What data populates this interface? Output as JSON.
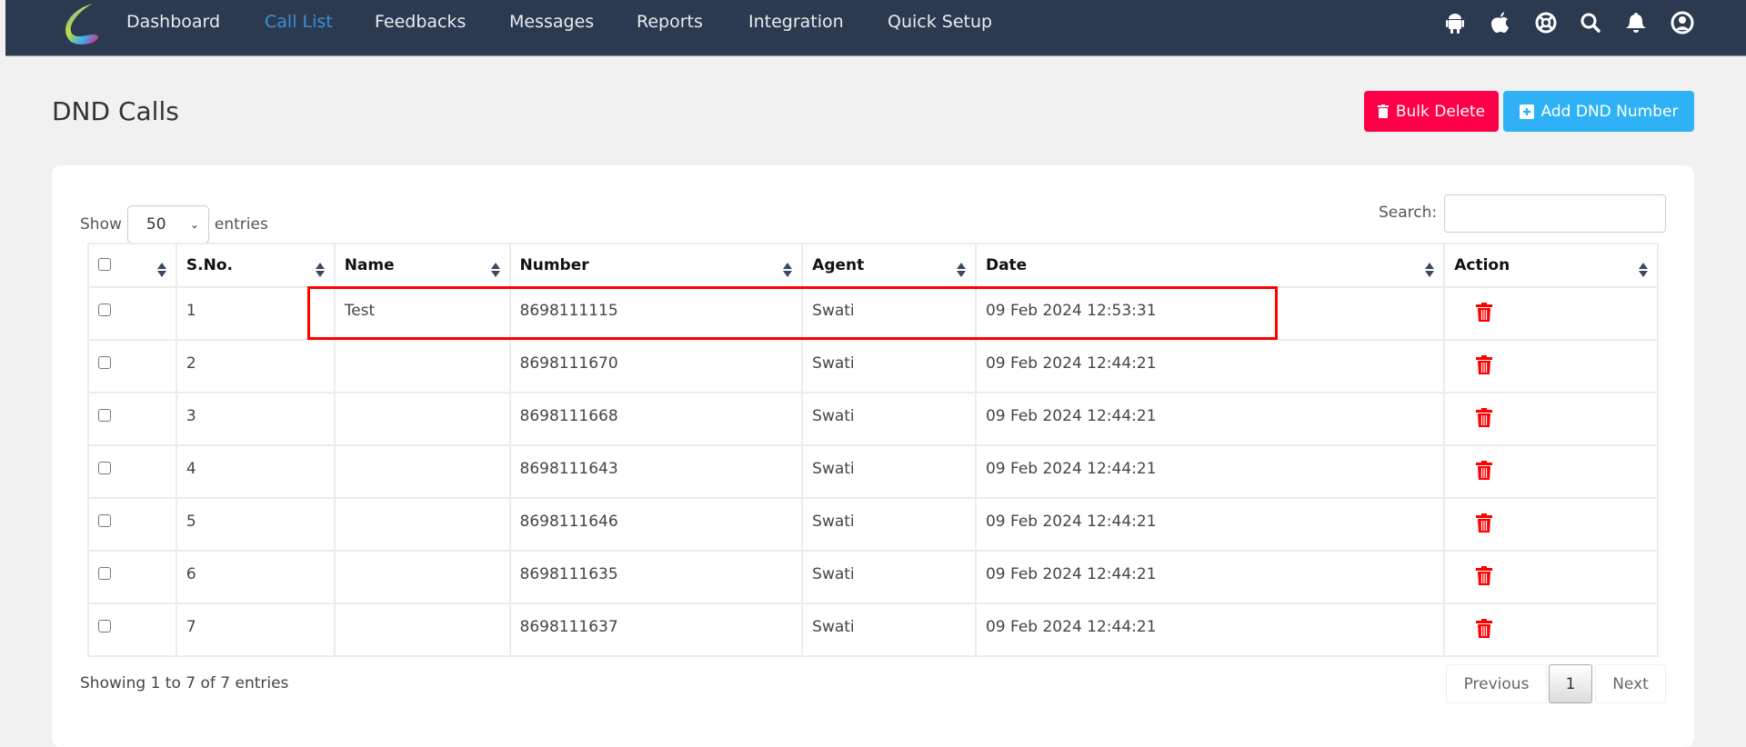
{
  "nav": {
    "items": [
      {
        "label": "Dashboard",
        "active": false
      },
      {
        "label": "Call List",
        "active": true
      },
      {
        "label": "Feedbacks",
        "active": false
      },
      {
        "label": "Messages",
        "active": false
      },
      {
        "label": "Reports",
        "active": false
      },
      {
        "label": "Integration",
        "active": false
      },
      {
        "label": "Quick Setup",
        "active": false
      }
    ],
    "icons": [
      "android-icon",
      "apple-icon",
      "lifebuoy-icon",
      "search-icon",
      "bell-icon",
      "user-icon"
    ]
  },
  "page": {
    "title": "DND Calls",
    "bulk_delete": "Bulk Delete",
    "add_dnd": "Add DND Number"
  },
  "controls": {
    "show": "Show",
    "page_size": "50",
    "entries": "entries",
    "search_label": "Search:",
    "search_value": ""
  },
  "table": {
    "headers": [
      "S.No.",
      "Name",
      "Number",
      "Agent",
      "Date",
      "Action"
    ],
    "rows": [
      {
        "sno": "1",
        "name": "Test",
        "number": "8698111115",
        "agent": "Swati",
        "date": "09 Feb 2024 12:53:31"
      },
      {
        "sno": "2",
        "name": "",
        "number": "8698111670",
        "agent": "Swati",
        "date": "09 Feb 2024 12:44:21"
      },
      {
        "sno": "3",
        "name": "",
        "number": "8698111668",
        "agent": "Swati",
        "date": "09 Feb 2024 12:44:21"
      },
      {
        "sno": "4",
        "name": "",
        "number": "8698111643",
        "agent": "Swati",
        "date": "09 Feb 2024 12:44:21"
      },
      {
        "sno": "5",
        "name": "",
        "number": "8698111646",
        "agent": "Swati",
        "date": "09 Feb 2024 12:44:21"
      },
      {
        "sno": "6",
        "name": "",
        "number": "8698111635",
        "agent": "Swati",
        "date": "09 Feb 2024 12:44:21"
      },
      {
        "sno": "7",
        "name": "",
        "number": "8698111637",
        "agent": "Swati",
        "date": "09 Feb 2024 12:44:21"
      }
    ]
  },
  "footer": {
    "info": "Showing 1 to 7 of 7 entries",
    "previous": "Previous",
    "current_page": "1",
    "next": "Next"
  },
  "colors": {
    "nav_bg": "#2c3a4f",
    "active_nav": "#3a8fd6",
    "bulk_delete": "#ff0048",
    "add_dnd": "#2eb2f5",
    "trash": "#ff0000",
    "highlight": "#ff0000"
  }
}
